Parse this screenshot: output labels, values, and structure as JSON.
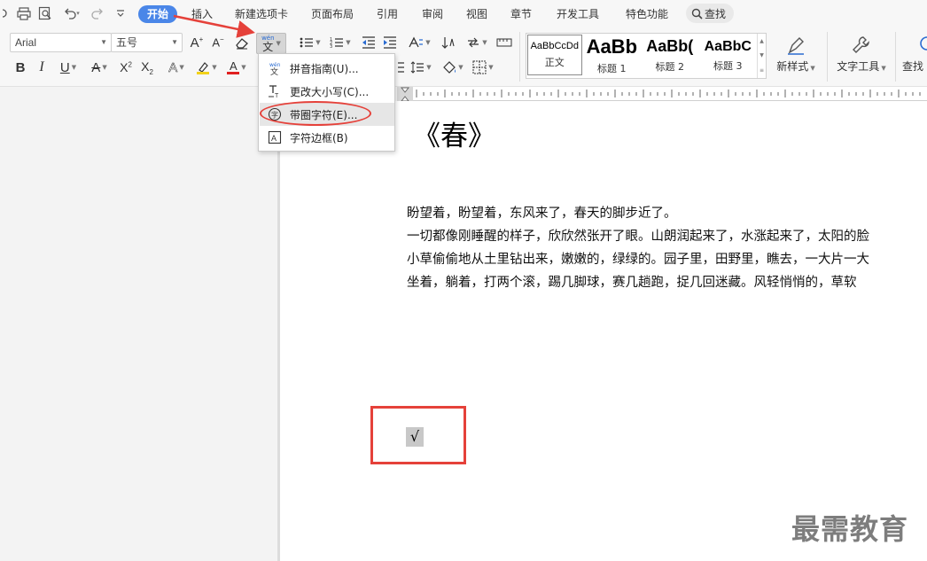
{
  "menubar": {
    "tabs": [
      {
        "label": "开始",
        "active": true
      },
      {
        "label": "插入"
      },
      {
        "label": "新建选项卡"
      },
      {
        "label": "页面布局"
      },
      {
        "label": "引用"
      },
      {
        "label": "审阅"
      },
      {
        "label": "视图"
      },
      {
        "label": "章节"
      },
      {
        "label": "开发工具"
      },
      {
        "label": "特色功能"
      }
    ],
    "search_label": "查找"
  },
  "ribbon": {
    "font_name": "Arial",
    "font_size": "五号",
    "styles": [
      {
        "sample": "AaBbCcDd",
        "name": "正文"
      },
      {
        "sample": "AaBb",
        "name": "标题 1"
      },
      {
        "sample": "AaBb(",
        "name": "标题 2"
      },
      {
        "sample": "AaBbC",
        "name": "标题 3"
      }
    ],
    "new_style_label": "新样式",
    "text_tools_label": "文字工具",
    "find_label": "查找",
    "pinyin_icon_label": "wén"
  },
  "dropdown": {
    "items": [
      {
        "label": "拼音指南(U)...",
        "icon": "pinyin-icon"
      },
      {
        "label": "更改大小写(C)...",
        "icon": "change-case-icon"
      },
      {
        "label": "带圈字符(E)...",
        "icon": "enclosed-character-icon"
      },
      {
        "label": "字符边框(B)",
        "icon": "character-border-icon"
      }
    ]
  },
  "document": {
    "title": "《春》",
    "paragraphs": [
      "盼望着，盼望着，东风来了，春天的脚步近了。",
      "一切都像刚睡醒的样子，欣欣然张开了眼。山朗润起来了，水涨起来了，太阳的脸",
      "小草偷偷地从土里钻出来，嫩嫩的，绿绿的。园子里，田野里，瞧去，一大片一大",
      "坐着，躺着，打两个滚，踢几脚球，赛几趟跑，捉几回迷藏。风轻悄悄的，草软"
    ],
    "selected_char": "√"
  },
  "watermark": "最需教育",
  "colors": {
    "accent": "#4a86e8",
    "annotation_red": "#e5413a",
    "font_color_red": "#e02020"
  }
}
